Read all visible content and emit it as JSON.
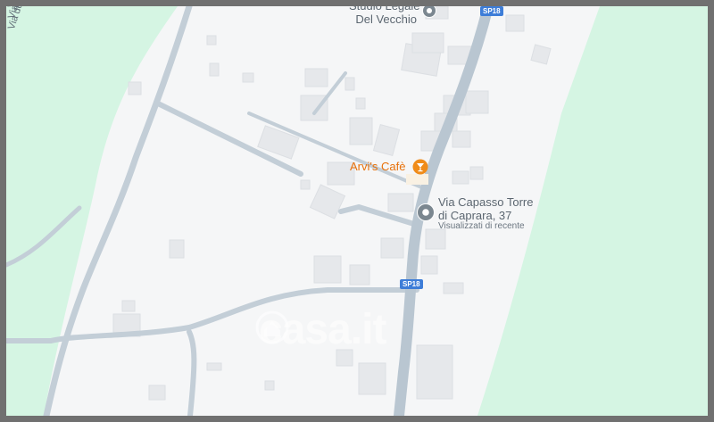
{
  "map": {
    "colors": {
      "background": "#f5f6f7",
      "green_area": "#d5f5e3",
      "road": "#c3ced7",
      "building": "#e6e8eb",
      "poi_pin": "#7b8790",
      "cafe_pin": "#f08c1a",
      "shield": "#3d7dd8"
    },
    "roads": {
      "via_dei_giardini": "Via dei Giardini",
      "sp18": "SP18"
    },
    "pois": {
      "studio_legale": {
        "line1": "Studio Legale",
        "line2": "Del Vecchio",
        "icon": "map-pin-icon"
      },
      "arvis_cafe": {
        "name": "Arvi's Cafè",
        "icon": "cocktail-bar-icon"
      },
      "address": {
        "line1": "Via Capasso Torre",
        "line2": "di Caprara, 37",
        "subtitle": "Visualizzati di recente",
        "icon": "map-pin-icon"
      }
    },
    "watermark": "casa.it"
  }
}
